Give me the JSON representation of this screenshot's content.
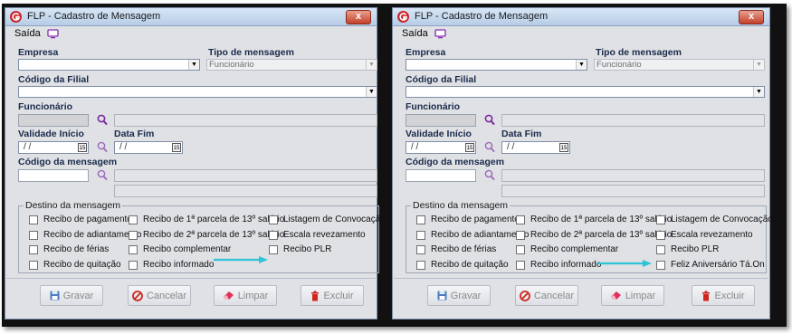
{
  "windows": [
    {
      "title": "FLP - Cadastro de Mensagem",
      "close_label": "x",
      "menu": {
        "saida": "Saída"
      },
      "empresa": {
        "label": "Empresa",
        "value": ""
      },
      "tipo": {
        "label": "Tipo de mensagem",
        "value": "Funcionário"
      },
      "filial": {
        "label": "Código da Filial",
        "value": ""
      },
      "funcionario": {
        "label": "Funcionário"
      },
      "validade_inicio": {
        "label": "Validade Início",
        "value": "/ /",
        "cal": "15"
      },
      "data_fim": {
        "label": "Data Fim",
        "value": "/ /",
        "cal": "15"
      },
      "codigo_mensagem": {
        "label": "Código da mensagem"
      },
      "destino": {
        "title": "Destino da mensagem",
        "col1": [
          "Recibo de pagamento",
          "Recibo de adiantamento",
          "Recibo de férias",
          "Recibo de quitação"
        ],
        "col2": [
          "Recibo de 1ª parcela de 13º salário",
          "Recibo de 2ª parcela de 13º salário",
          "Recibo complementar",
          "Recibo informado"
        ],
        "col3": [
          "Listagem de Convocação",
          "Escala revezamento",
          "Recibo PLR"
        ]
      },
      "buttons": {
        "gravar": "Gravar",
        "cancelar": "Cancelar",
        "limpar": "Limpar",
        "excluir": "Excluir"
      }
    },
    {
      "title": "FLP - Cadastro de Mensagem",
      "close_label": "x",
      "menu": {
        "saida": "Saída"
      },
      "empresa": {
        "label": "Empresa",
        "value": ""
      },
      "tipo": {
        "label": "Tipo de mensagem",
        "value": "Funcionário"
      },
      "filial": {
        "label": "Código da Filial",
        "value": ""
      },
      "funcionario": {
        "label": "Funcionário"
      },
      "validade_inicio": {
        "label": "Validade Início",
        "value": "/ /",
        "cal": "15"
      },
      "data_fim": {
        "label": "Data Fim",
        "value": "/ /",
        "cal": "15"
      },
      "codigo_mensagem": {
        "label": "Código da mensagem"
      },
      "destino": {
        "title": "Destino da mensagem",
        "col1": [
          "Recibo de pagamento",
          "Recibo de adiantamento",
          "Recibo de férias",
          "Recibo de quitação"
        ],
        "col2": [
          "Recibo de 1ª parcela de 13º salário",
          "Recibo de 2ª parcela de 13º salário",
          "Recibo complementar",
          "Recibo informado"
        ],
        "col3": [
          "Listagem de Convocação",
          "Escala revezamento",
          "Recibo PLR",
          "Feliz Aniversário Tá.On"
        ]
      },
      "buttons": {
        "gravar": "Gravar",
        "cancelar": "Cancelar",
        "limpar": "Limpar",
        "excluir": "Excluir"
      }
    }
  ],
  "colors": {
    "arrow": "#2ec4d6",
    "title_bg": "#c6d9ef",
    "close": "#c4402a",
    "search_icon": "#7a2aa0"
  }
}
